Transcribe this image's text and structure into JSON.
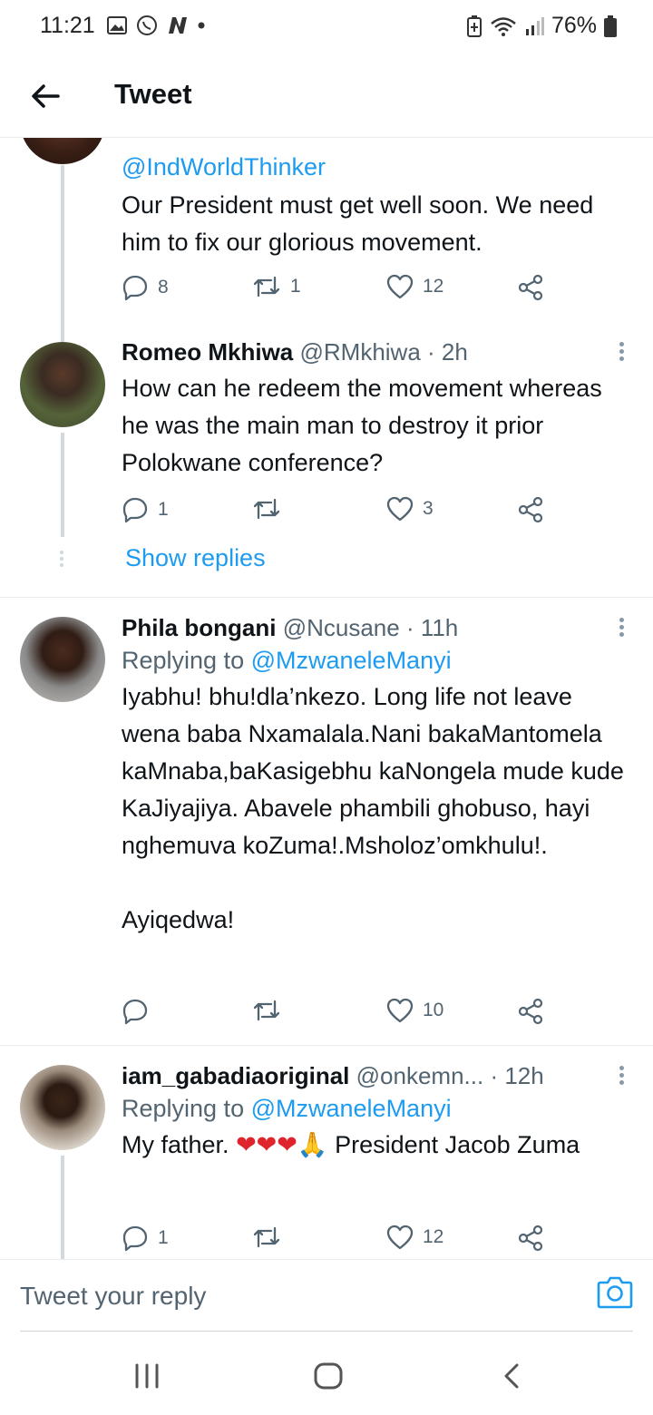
{
  "status_bar": {
    "time": "11:21",
    "battery": "76%",
    "left_icons": [
      "gallery-icon",
      "whatsapp-icon",
      "n-app-icon",
      "dot-icon"
    ],
    "right_icons": [
      "battery-saver-icon",
      "wifi-icon",
      "signal-icon",
      "battery-icon"
    ]
  },
  "header": {
    "title": "Tweet",
    "back_icon": "arrow-left-icon"
  },
  "tweets": [
    {
      "handle_mention": "@IndWorldThinker",
      "text": "Our President must get well soon. We need him to fix our glorious movement.",
      "replies": "8",
      "retweets": "1",
      "likes": "12"
    },
    {
      "name": "Romeo Mkhiwa",
      "handle": "@RMkhiwa",
      "time": "· 2h",
      "text": "How can he redeem the movement whereas he was the main man to destroy it prior Polokwane conference?",
      "replies": "1",
      "retweets": "",
      "likes": "3",
      "show_replies": "Show replies"
    },
    {
      "name": "Phila bongani",
      "handle": "@Ncusane",
      "time": "· 11h",
      "replying_label": "Replying to",
      "replying_to": "@MzwaneleManyi",
      "text": "Iyabhu! bhu!dla’nkezo. Long life not leave wena baba Nxamalala.Nani bakaMantomela kaMnaba,baKasigebhu kaNongela mude kude KaJiyajiya. Abavele phambili ghobuso, hayi nghemuva koZuma!.Msholoz’omkhulu!.\n\nAyiqedwa!",
      "replies": "",
      "retweets": "",
      "likes": "10"
    },
    {
      "name": "iam_gabadiaoriginal",
      "handle": "@onkemn...",
      "time": "· 12h",
      "replying_label": "Replying to",
      "replying_to": "@MzwaneleManyi",
      "text_before": "My father. ",
      "emojis": "❤❤❤🙏",
      "text_after": " President Jacob Zuma",
      "replies": "1",
      "retweets": "",
      "likes": "12"
    }
  ],
  "reply_bar": {
    "placeholder": "Tweet your reply",
    "camera_icon": "camera-icon"
  },
  "nav_bar": {
    "icons": [
      "recent-apps-icon",
      "home-icon",
      "back-icon"
    ]
  },
  "colors": {
    "accent": "#1d9bf0",
    "text": "#0f1419",
    "secondary": "#536471",
    "divider": "#e6ecf0"
  }
}
